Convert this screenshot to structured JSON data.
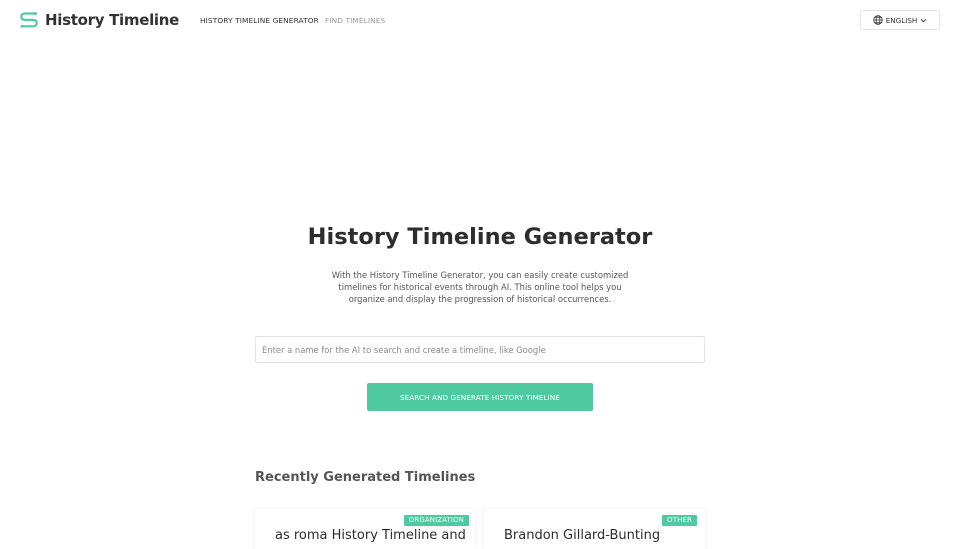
{
  "header": {
    "logo_text": "History Timeline",
    "nav": [
      {
        "label": "HISTORY TIMELINE GENERATOR",
        "active": true
      },
      {
        "label": "FIND TIMELINES",
        "active": false
      }
    ],
    "language": "ENGLISH"
  },
  "hero": {
    "title": "History Timeline Generator",
    "description": "With the History Timeline Generator, you can easily create customized timelines for historical events through AI. This online tool helps you organize and display the progression of historical occurrences.",
    "search_placeholder": "Enter a name for the AI to search and create a timeline, like Google",
    "search_value": "",
    "button_label": "SEARCH AND GENERATE HISTORY TIMELINE"
  },
  "recent": {
    "title": "Recently Generated Timelines",
    "cards": [
      {
        "badge": "ORGANIZATION",
        "title": "as roma History Timeline and"
      },
      {
        "badge": "OTHER",
        "title": "Brandon Gillard-Bunting"
      }
    ]
  },
  "colors": {
    "accent": "#4fcaa0",
    "text": "#2d2d2d",
    "muted": "#9a9a9a"
  },
  "icons": {
    "logo": "timeline-logo-icon",
    "language": "globe-icon",
    "dropdown": "chevron-down-icon"
  }
}
